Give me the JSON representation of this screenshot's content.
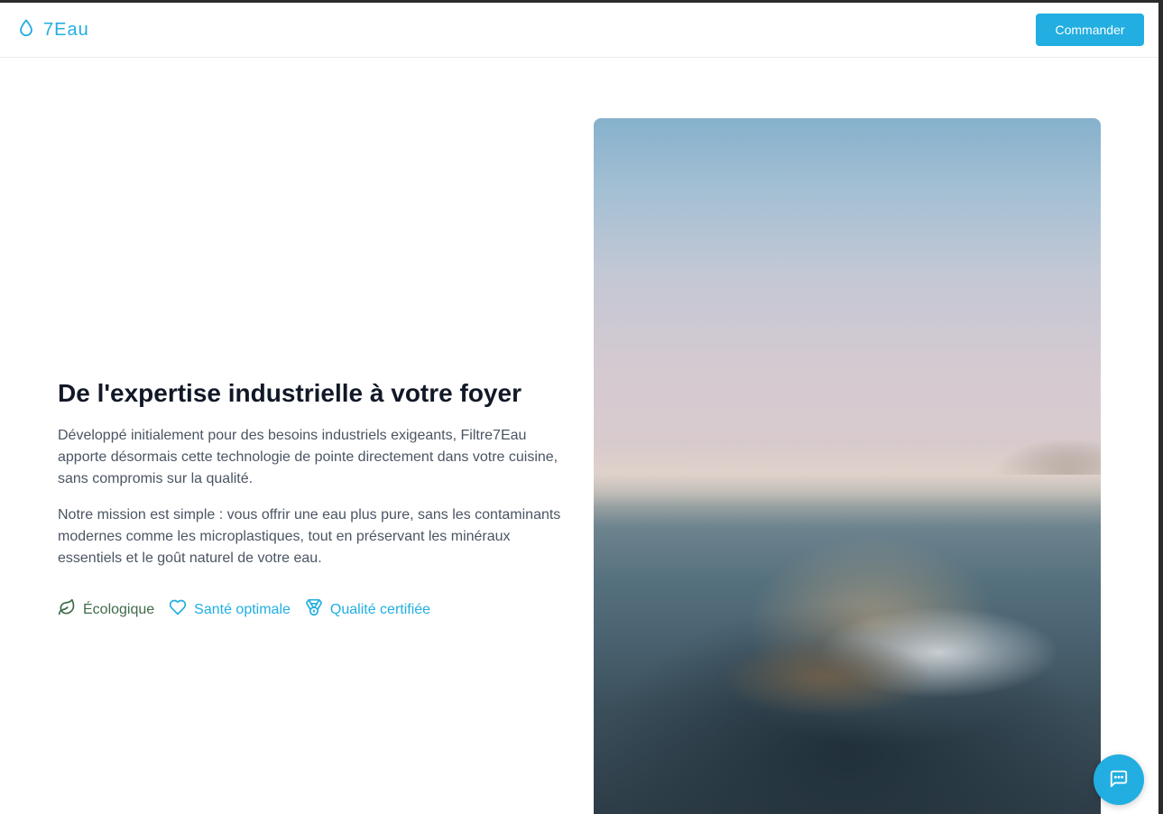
{
  "header": {
    "logo_text": "7Eau",
    "order_button_label": "Commander"
  },
  "section": {
    "title": "De l'expertise industrielle à votre foyer",
    "paragraph_1": "Développé initialement pour des besoins industriels exigeants, Filtre7Eau apporte désormais cette technologie de pointe directement dans votre cuisine, sans compromis sur la qualité.",
    "paragraph_2": "Notre mission est simple : vous offrir une eau plus pure, sans les contaminants modernes comme les microplastiques, tout en préservant les minéraux essentiels et le goût naturel de votre eau.",
    "features": [
      {
        "label": "Écologique",
        "icon": "leaf-icon",
        "color": "#3f6b4a"
      },
      {
        "label": "Santé optimale",
        "icon": "heart-icon",
        "color": "#22aee0"
      },
      {
        "label": "Qualité certifiée",
        "icon": "medal-icon",
        "color": "#22aee0"
      }
    ]
  },
  "colors": {
    "accent": "#22aee0",
    "title": "#111827",
    "text": "#4b5563"
  },
  "chat": {
    "icon": "chat-icon"
  }
}
